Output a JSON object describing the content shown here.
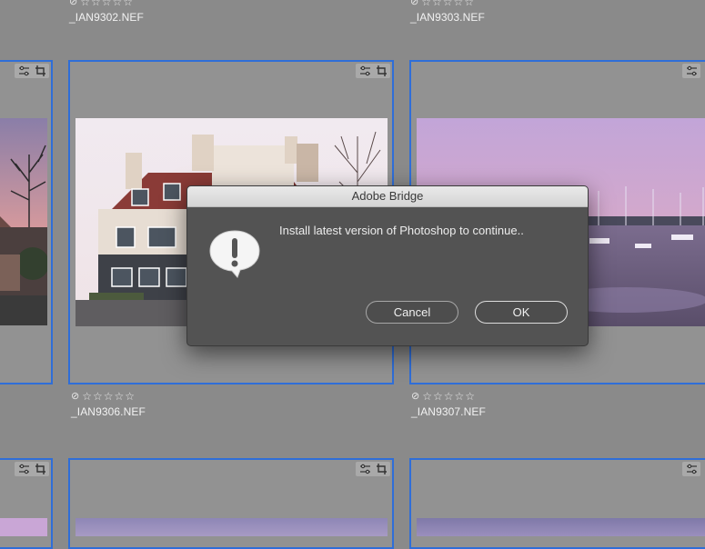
{
  "top_row": [
    {
      "filename": "_IAN9302.NEF"
    },
    {
      "filename": "_IAN9303.NEF"
    }
  ],
  "middle_row": [
    {
      "filename": "_IAN9306.NEF",
      "rating": 0,
      "rejected": false
    },
    {
      "filename": "_IAN9307.NEF",
      "rating": 0,
      "rejected": false
    }
  ],
  "badges": {
    "adjust_icon": "sliders-icon",
    "crop_icon": "crop-icon"
  },
  "dialog": {
    "title": "Adobe Bridge",
    "message": "Install latest version of Photoshop to continue..",
    "cancel_label": "Cancel",
    "ok_label": "OK",
    "icon": "alert-icon"
  },
  "colors": {
    "selection_border": "#2f6ed8",
    "dialog_bg": "#535353"
  }
}
